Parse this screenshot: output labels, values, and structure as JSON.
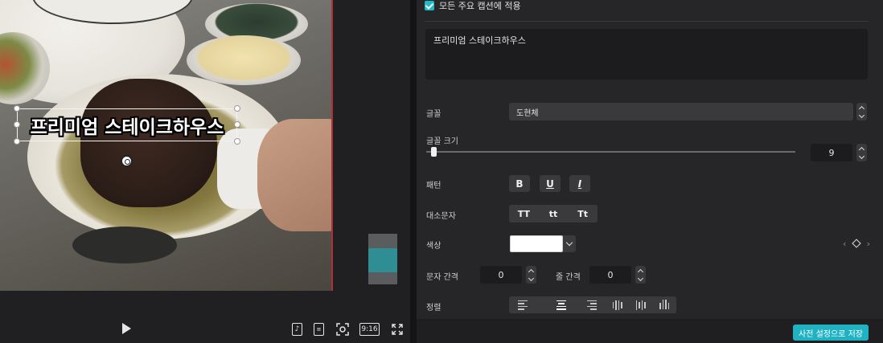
{
  "preview": {
    "caption": "프리미엄 스테이크하우스",
    "aspect_label": "9:16"
  },
  "panel": {
    "apply_all_label": "모든 주요 캡션에 적용",
    "caption_text": "프리미엄 스테이크하우스",
    "font_label": "글꼴",
    "font_value": "도현체",
    "font_size_label": "글꼴 크기",
    "font_size_value": "9",
    "font_size_fraction": 0.015,
    "pattern_label": "패턴",
    "bold_glyph": "B",
    "underline_glyph": "U",
    "italic_glyph": "I",
    "case_label": "대소문자",
    "case_options": [
      "TT",
      "tt",
      "Tt"
    ],
    "color_label": "색상",
    "color_value": "#ffffff",
    "letter_spacing_label": "문자 간격",
    "letter_spacing_value": "0",
    "line_spacing_label": "줄 간격",
    "line_spacing_value": "0",
    "align_label": "정렬",
    "save_preset_label": "사전 설정으로 저장"
  },
  "colors": {
    "accent": "#1fb2c3",
    "panel_bg": "#262628",
    "preview_border": "#b0303a"
  }
}
